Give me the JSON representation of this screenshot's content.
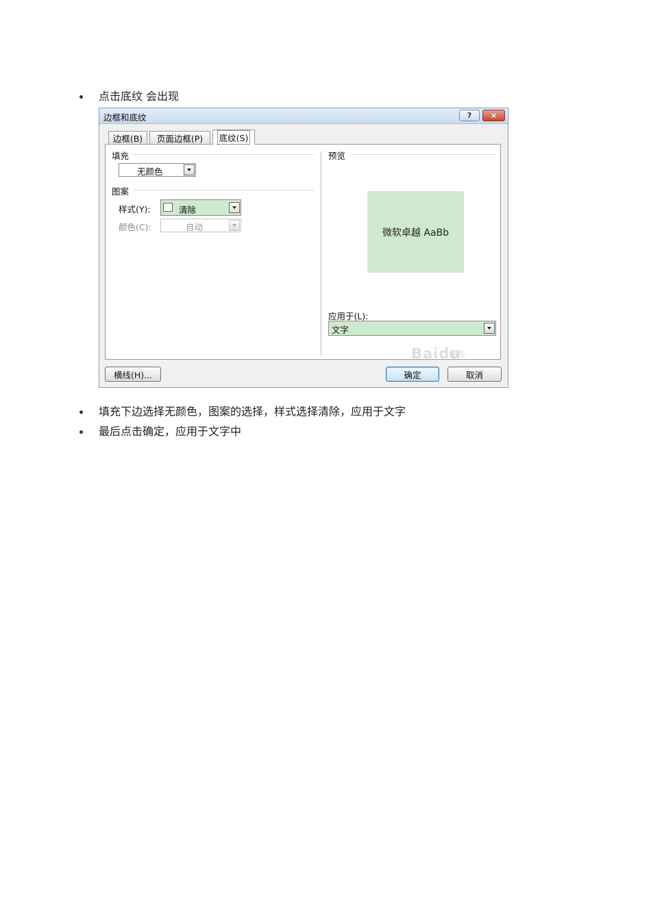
{
  "bullets": [
    "点击底纹 会出现",
    "填充下边选择无颜色，图案的选择，样式选择清除，应用于文字",
    "最后点击确定，应用于文字中"
  ],
  "dialog": {
    "title": "边框和底纹",
    "help_label": "?",
    "close_label": "×",
    "tabs": [
      {
        "label": "边框(B)"
      },
      {
        "label": "页面边框(P)"
      },
      {
        "label": "底纹(S)"
      }
    ],
    "active_tab": 2,
    "fill": {
      "group_label": "填充",
      "value": "无颜色"
    },
    "pattern": {
      "group_label": "图案",
      "style_label": "样式(Y):",
      "style_value": "清除",
      "color_label": "颜色(C):",
      "color_value": "自动"
    },
    "preview": {
      "group_label": "预览",
      "sample_text": "微软卓越 AaBb",
      "sample_bg": "#cfe9cf"
    },
    "apply_to": {
      "label": "应用于(L):",
      "value": "文字",
      "bg": "#cfe9cf"
    },
    "buttons": {
      "horizontal_line": "横线(H)...",
      "ok": "确定",
      "cancel": "取消"
    },
    "watermark": {
      "logo": "Baidu",
      "sub": "经验"
    }
  }
}
